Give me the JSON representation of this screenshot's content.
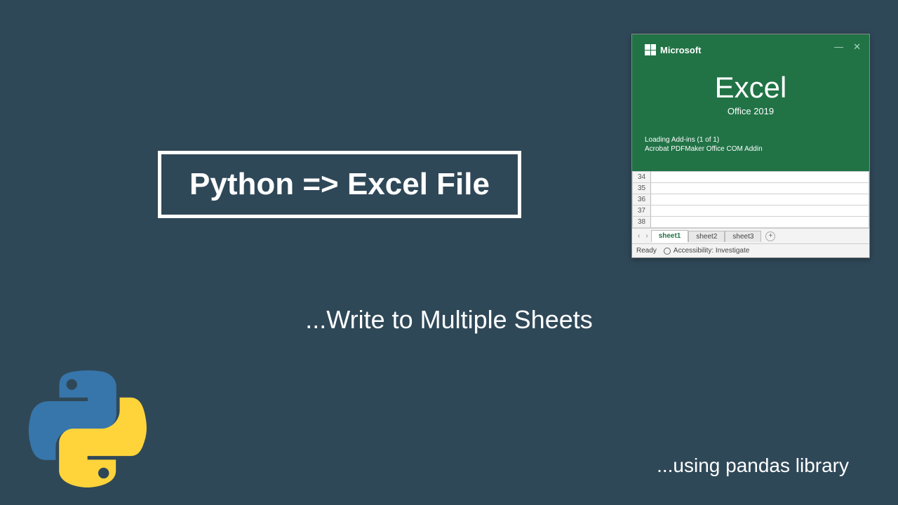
{
  "main": {
    "title": "Python => Excel File",
    "subtitle": "...Write to Multiple Sheets",
    "footer": "...using pandas library"
  },
  "excel": {
    "brand": "Microsoft",
    "product": "Excel",
    "edition": "Office 2019",
    "loading": "Loading Add-ins (1 of 1)",
    "addin": "Acrobat PDFMaker Office COM Addin",
    "window_controls": {
      "minimize": "—",
      "close": "✕"
    },
    "rows": [
      "34",
      "35",
      "36",
      "37",
      "38"
    ],
    "tabs": {
      "prev": "‹",
      "next": "›",
      "sheet1": "sheet1",
      "sheet2": "sheet2",
      "sheet3": "sheet3",
      "add": "+"
    },
    "status": {
      "ready": "Ready",
      "accessibility": "Accessibility: Investigate"
    }
  }
}
